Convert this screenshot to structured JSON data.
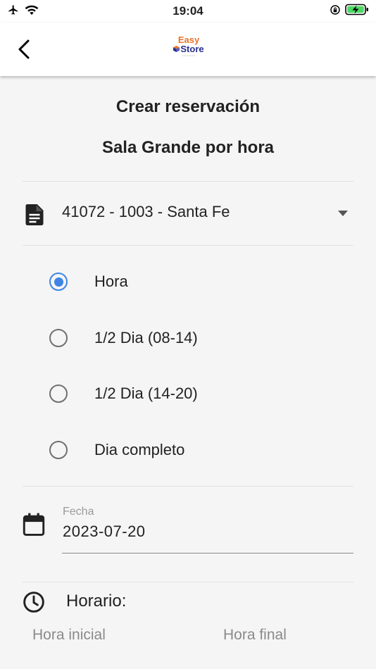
{
  "status_bar": {
    "time": "19:04"
  },
  "header": {
    "logo_top": "Easy",
    "logo_bottom": "Store"
  },
  "page": {
    "title": "Crear reservación",
    "subtitle": "Sala Grande por hora"
  },
  "store_select": {
    "value": "41072 - 1003 - Santa Fe"
  },
  "duration_options": [
    {
      "label": "Hora",
      "checked": true
    },
    {
      "label": "1/2 Dia (08-14)",
      "checked": false
    },
    {
      "label": "1/2 Dia (14-20)",
      "checked": false
    },
    {
      "label": "Dia completo",
      "checked": false
    }
  ],
  "date_field": {
    "label": "Fecha",
    "value": "2023-07-20"
  },
  "schedule": {
    "label": "Horario:",
    "start_placeholder": "Hora inicial",
    "end_placeholder": "Hora final"
  },
  "colors": {
    "accent": "#3d84e6",
    "logo_orange": "#e8742a",
    "logo_blue": "#2a2f8f",
    "battery_green": "#4cd964"
  }
}
